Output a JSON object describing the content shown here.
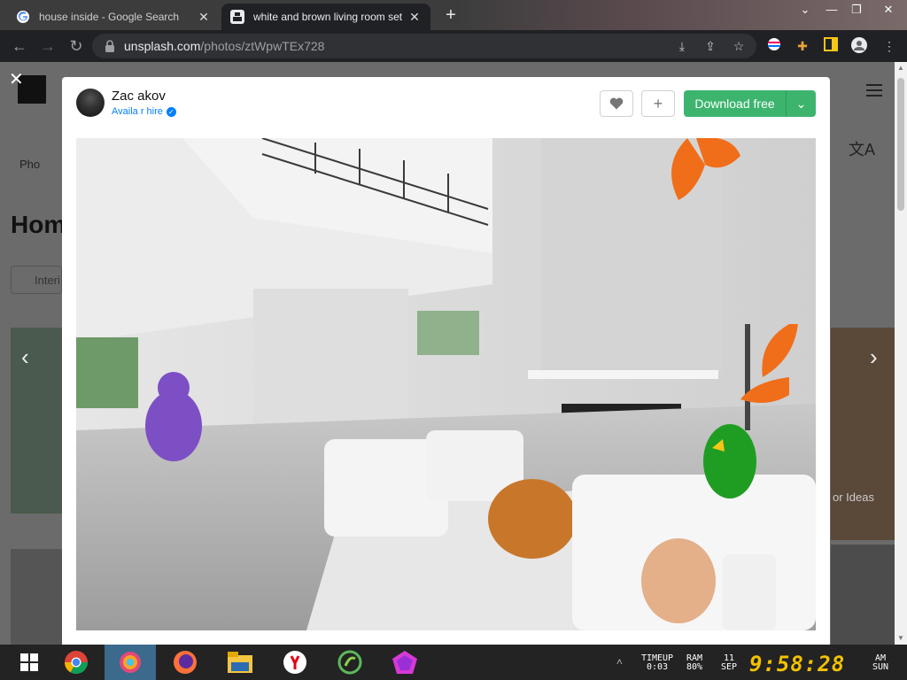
{
  "browser": {
    "tabs": [
      {
        "title": "house inside - Google Search",
        "active": false
      },
      {
        "title": "white and brown living room set",
        "active": true
      }
    ],
    "url_host": "unsplash.com",
    "url_path": "/photos/ztWpwTEx728"
  },
  "background_page": {
    "tab_label": "Pho",
    "heading": "Hom",
    "chip_label": "Interi",
    "side_text": "or Ideas"
  },
  "modal": {
    "author_name": "Zac   akov",
    "author_status": "Availa    r hire",
    "download_label": "Download free",
    "icons": [
      "heart-icon",
      "plus-icon",
      "chevron-down-icon"
    ]
  },
  "taskbar": {
    "timeup_label": "TIMEUP",
    "timeup_value": "0:03",
    "ram_label": "RAM",
    "ram_value": "80%",
    "date_day": "11",
    "date_month": "SEP",
    "time": "9:58:28",
    "ampm": "AM",
    "weekday": "SUN"
  },
  "colors": {
    "download_green": "#3cb46e",
    "link_blue": "#007fff",
    "clock_yellow": "#f2c200"
  }
}
